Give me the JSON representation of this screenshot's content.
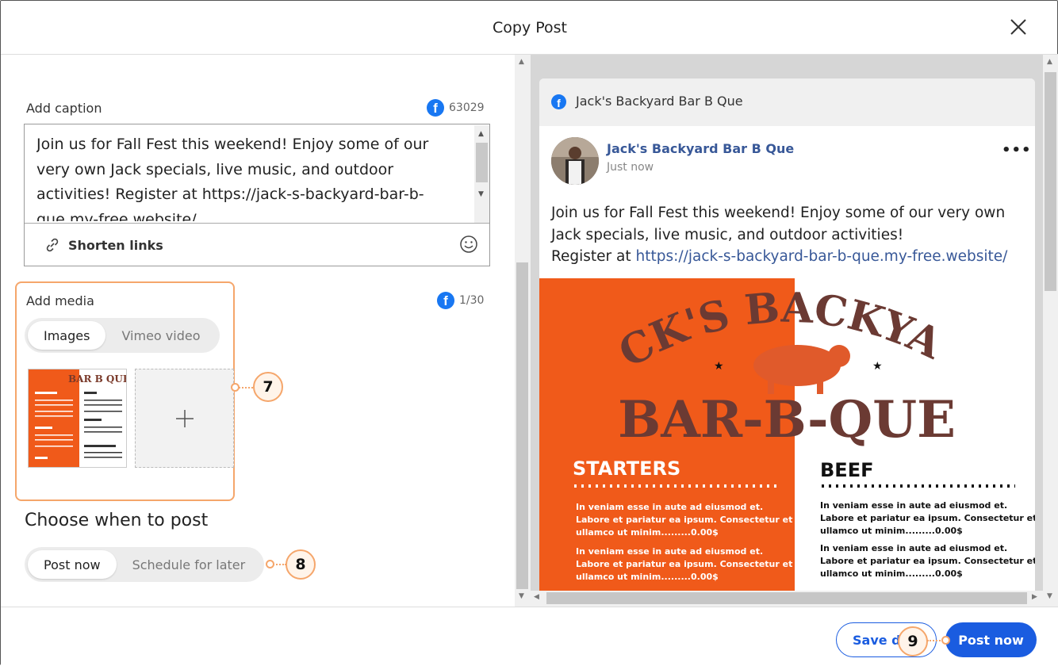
{
  "dialog": {
    "title": "Copy Post"
  },
  "caption": {
    "label": "Add caption",
    "fb_count": "63029",
    "text": "Join us for Fall Fest this weekend! Enjoy some of our very own Jack specials, live music, and outdoor activities! Register at https://jack-s-backyard-bar-b-que.my-free.website/",
    "shorten_label": "Shorten links"
  },
  "media": {
    "label": "Add media",
    "fb_count": "1/30",
    "tabs": [
      {
        "label": "Images",
        "selected": true
      },
      {
        "label": "Vimeo video",
        "selected": false
      }
    ]
  },
  "schedule": {
    "heading": "Choose when to post",
    "options": [
      {
        "label": "Post now",
        "selected": true
      },
      {
        "label": "Schedule for later",
        "selected": false
      }
    ]
  },
  "callouts": [
    "7",
    "8",
    "9"
  ],
  "preview": {
    "header_title": "Jack's Backyard Bar B Que",
    "page_name": "Jack's Backyard Bar B Que",
    "time": "Just now",
    "more": "•••",
    "text_line1": "Join us for Fall Fest this weekend! Enjoy some of our very own",
    "text_line2": "Jack specials, live music, and outdoor activities!",
    "text_line3_prefix": "Register at ",
    "link": "https://jack-s-backyard-bar-b-que.my-free.website/",
    "menu": {
      "brand_top": "JACK'S BACKYARD",
      "brand_bottom": "BAR-B-QUE",
      "left_heading": "STARTERS",
      "right_heading": "BEEF",
      "item_line1": "In veniam esse in aute ad eiusmod et.",
      "item_line2": "Labore et pariatur ea ipsum. Consectetur et",
      "item_line3": "ullamco ut minim.........0.00$"
    }
  },
  "footer": {
    "save_label": "Save d",
    "post_label": "Post now"
  },
  "colors": {
    "accent": "#1a5ce0",
    "callout": "#f5a66b",
    "facebook": "#1877f2",
    "menu_orange": "#f05a1a"
  },
  "icons": [
    "close-icon",
    "facebook-icon",
    "link-icon",
    "emoji-icon",
    "plus-icon"
  ]
}
